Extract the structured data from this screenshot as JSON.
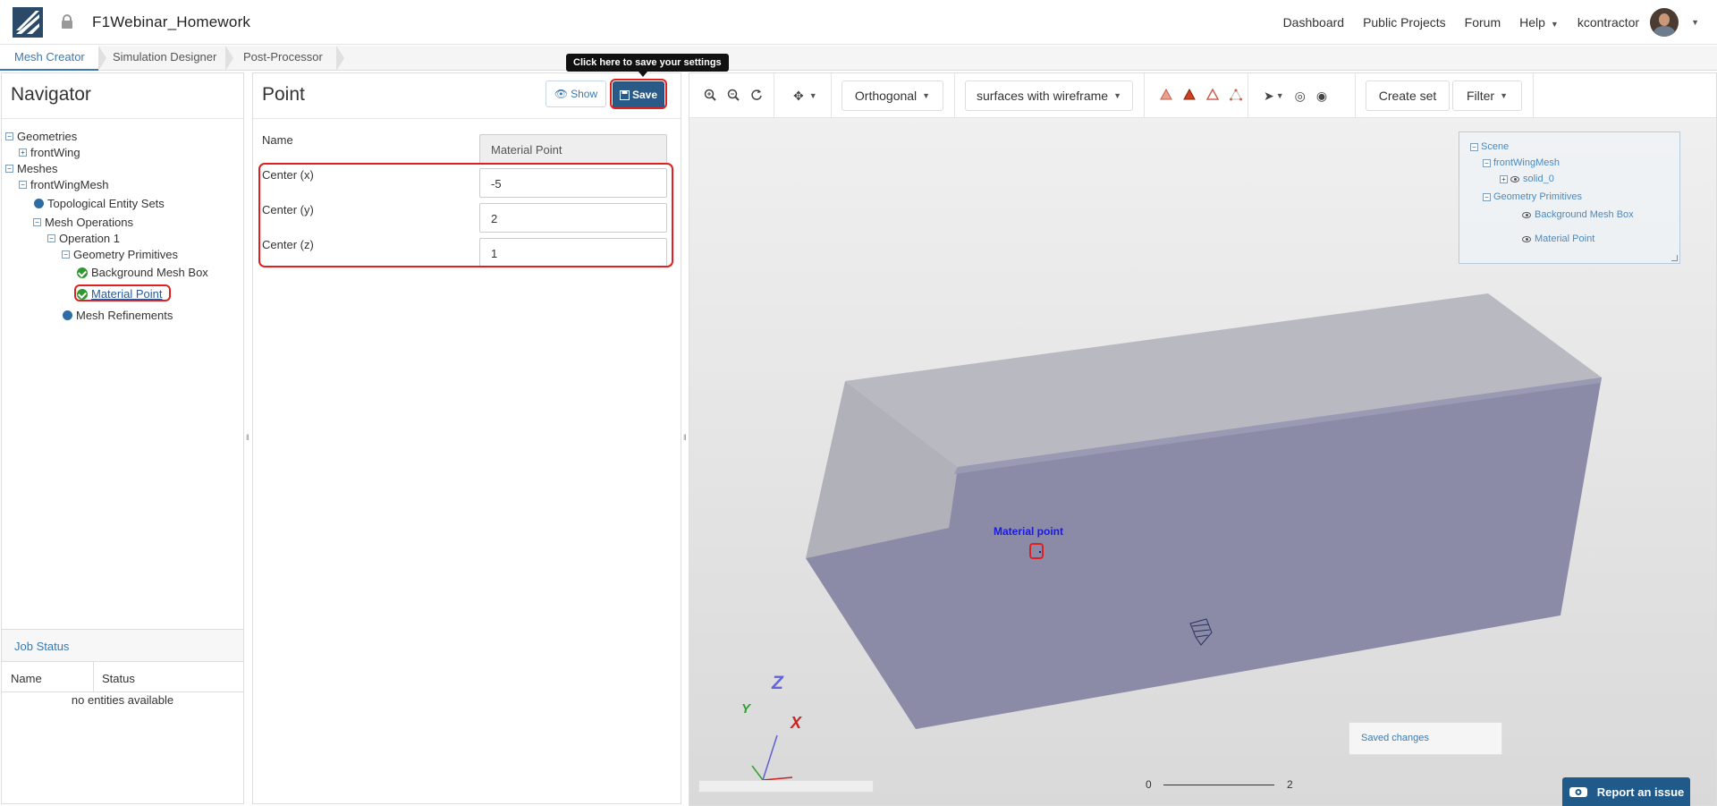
{
  "header": {
    "project_title": "F1Webinar_Homework",
    "nav": [
      "Dashboard",
      "Public Projects",
      "Forum",
      "Help"
    ],
    "username": "kcontractor"
  },
  "tabs": [
    "Mesh Creator",
    "Simulation Designer",
    "Post-Processor"
  ],
  "navigator": {
    "title": "Navigator",
    "tree": [
      {
        "label": "Geometries",
        "icon": "toggle-minus"
      },
      {
        "label": "frontWing",
        "icon": "toggle-plus"
      },
      {
        "label": "Meshes",
        "icon": "toggle-minus"
      },
      {
        "label": "frontWingMesh",
        "icon": "toggle-minus"
      },
      {
        "label": "Topological Entity Sets",
        "icon": "blue-dot"
      },
      {
        "label": "Mesh Operations",
        "icon": "toggle-minus"
      },
      {
        "label": "Operation 1",
        "icon": "toggle-minus"
      },
      {
        "label": "Geometry Primitives",
        "icon": "toggle-minus"
      },
      {
        "label": "Background Mesh Box",
        "icon": "green-check"
      },
      {
        "label": "Material Point",
        "icon": "green-check"
      },
      {
        "label": "Mesh Refinements",
        "icon": "blue-dot"
      }
    ]
  },
  "job_status": {
    "title": "Job Status",
    "columns": [
      "Name",
      "Status"
    ],
    "empty_text": "no entities available"
  },
  "point_panel": {
    "title": "Point",
    "show_label": "Show",
    "save_label": "Save",
    "tooltip": "Click here to save your settings",
    "fields": [
      {
        "label": "Name",
        "value": "Material Point"
      },
      {
        "label": "Center (x)",
        "value": "-5"
      },
      {
        "label": "Center (y)",
        "value": "2"
      },
      {
        "label": "Center (z)",
        "value": "1"
      }
    ]
  },
  "viewer": {
    "projection": "Orthogonal",
    "render_mode": "surfaces with wireframe",
    "create_set": "Create set",
    "filter": "Filter",
    "scene_tree": [
      {
        "label": "Scene"
      },
      {
        "label": "frontWingMesh"
      },
      {
        "label": "solid_0"
      },
      {
        "label": "Geometry Primitives"
      },
      {
        "label": "Background Mesh Box"
      },
      {
        "label": "Material Point"
      }
    ],
    "material_point_label": "Material point",
    "saved_changes": "Saved changes",
    "scale_min": "0",
    "scale_max": "2",
    "axes": {
      "x": "X",
      "y": "Y",
      "z": "Z"
    },
    "report_issue": "Report an issue",
    "colors": {
      "box_top": "#b8b8c0",
      "box_front": "#8a8aa8",
      "box_side": "#8e8eaa",
      "accent": "#3a7ab0"
    }
  }
}
